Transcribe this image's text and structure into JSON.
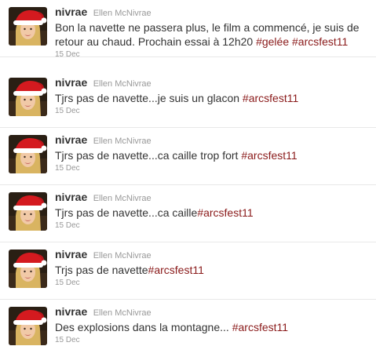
{
  "colors": {
    "hashtag": "#8a1a1a",
    "meta": "#999999",
    "text": "#333333"
  },
  "tweets": [
    {
      "screen_name": "nivrae",
      "full_name": "Ellen McNivrae",
      "text_line1": "Bon la navette ne passera plus, le film a commencé, je suis de",
      "text_line2": "retour au chaud. Prochain essai à 12h20 ",
      "hashtags": [
        "#gelée",
        "#arcsfest11"
      ],
      "timestamp": "15 Dec"
    },
    {
      "screen_name": "nivrae",
      "full_name": "Ellen McNivrae",
      "text": "Tjrs pas de navette...je suis un glacon ",
      "hashtag": "#arcsfest11",
      "timestamp": "15 Dec"
    },
    {
      "screen_name": "nivrae",
      "full_name": "Ellen McNivrae",
      "text": "Tjrs pas de navette...ca caille trop fort ",
      "hashtag": "#arcsfest11",
      "timestamp": "15 Dec"
    },
    {
      "screen_name": "nivrae",
      "full_name": "Ellen McNivrae",
      "text": "Tjrs pas de navette...ca caille",
      "hashtag": "#arcsfest11",
      "timestamp": "15 Dec"
    },
    {
      "screen_name": "nivrae",
      "full_name": "Ellen McNivrae",
      "text": "Trjs pas de navette",
      "hashtag": "#arcsfest11",
      "timestamp": "15 Dec"
    },
    {
      "screen_name": "nivrae",
      "full_name": "Ellen McNivrae",
      "text": "Des explosions dans la montagne... ",
      "hashtag": "#arcsfest11",
      "timestamp": "15 Dec"
    }
  ]
}
